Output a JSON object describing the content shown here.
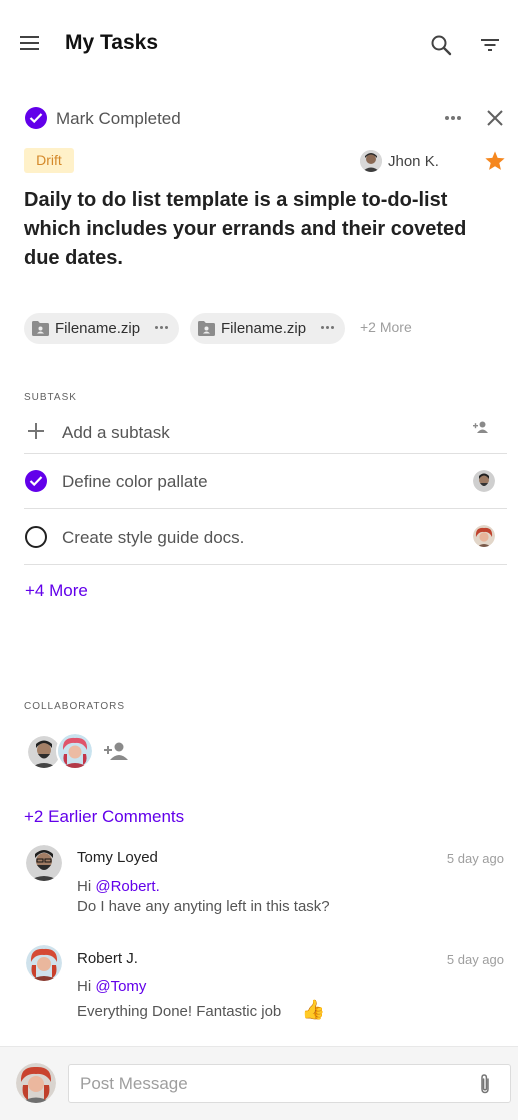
{
  "app_bar": {
    "title": "My Tasks",
    "menu_icon": "hamburger-menu-icon",
    "search_icon": "search-icon",
    "filter_icon": "filter-icon"
  },
  "task": {
    "mark_completed_label": "Mark Completed",
    "tag": "Drift",
    "assignee": "Jhon K.",
    "starred": true,
    "title": "Daily to do list template is a simple to-do-list which includes your errands and their coveted due dates."
  },
  "attachments": {
    "files": [
      {
        "name": "Filename.zip"
      },
      {
        "name": "Filename.zip"
      }
    ],
    "more_label": "+2 More"
  },
  "subtasks": {
    "section_label": "SUBTASK",
    "add_placeholder": "Add a subtask",
    "items": [
      {
        "label": "Define color pallate",
        "done": true
      },
      {
        "label": "Create style guide docs.",
        "done": false
      }
    ],
    "more_label": "+4 More"
  },
  "collaborators": {
    "section_label": "COLLABORATORS"
  },
  "comments": {
    "earlier_label": "+2 Earlier Comments",
    "items": [
      {
        "author": "Tomy Loyed",
        "time": "5 day ago",
        "greeting": "Hi",
        "mention": "@Robert.",
        "text": "Do I have any anyting left in this task?"
      },
      {
        "author": "Robert J.",
        "time": "5 day ago",
        "greeting": "Hi",
        "mention": "@Tomy",
        "text": "Everything Done! Fantastic job",
        "emoji": "👍"
      }
    ]
  },
  "composer": {
    "placeholder": "Post Message",
    "attach_icon": "paperclip-icon"
  },
  "colors": {
    "accent": "#6200ea",
    "star": "#f5871f",
    "tag_bg": "#fff1c9",
    "tag_text": "#d4892a"
  }
}
